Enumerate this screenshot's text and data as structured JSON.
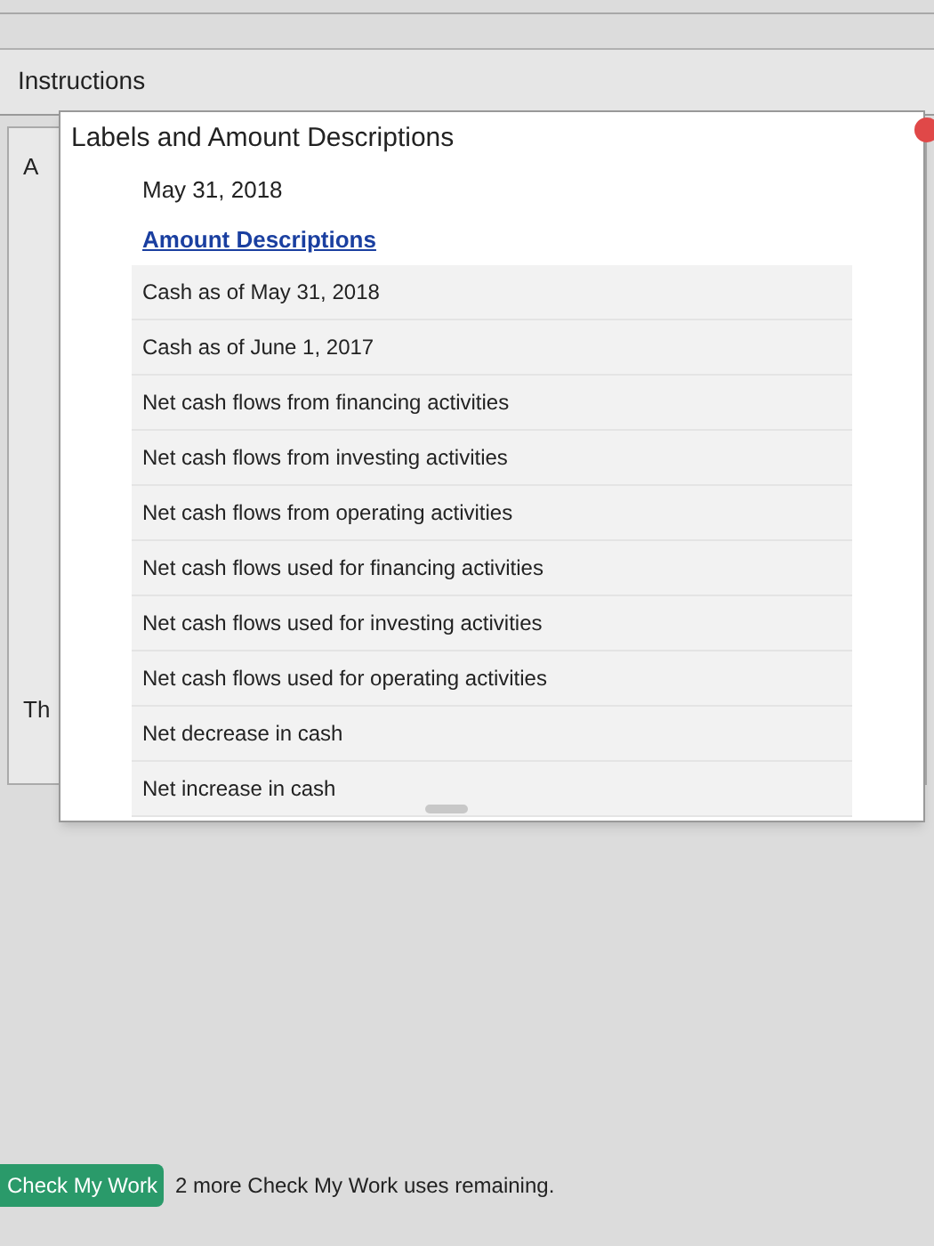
{
  "header": {
    "title": "Instructions"
  },
  "background_panel": {
    "texts": [
      "A",
      "Th"
    ]
  },
  "popup": {
    "title": "Labels and Amount Descriptions",
    "items": [
      {
        "kind": "label",
        "text": "May 31, 2018"
      },
      {
        "kind": "heading",
        "text": "Amount Descriptions"
      },
      {
        "kind": "option",
        "text": "Cash as of May 31, 2018"
      },
      {
        "kind": "option",
        "text": "Cash as of June 1, 2017"
      },
      {
        "kind": "option",
        "text": "Net cash flows from financing activities"
      },
      {
        "kind": "option",
        "text": "Net cash flows from investing activities"
      },
      {
        "kind": "option",
        "text": "Net cash flows from operating activities"
      },
      {
        "kind": "option",
        "text": "Net cash flows used for financing activities"
      },
      {
        "kind": "option",
        "text": "Net cash flows used for investing activities"
      },
      {
        "kind": "option",
        "text": "Net cash flows used for operating activities"
      },
      {
        "kind": "option",
        "text": "Net decrease in cash"
      },
      {
        "kind": "option",
        "text": "Net increase in cash"
      }
    ]
  },
  "footer": {
    "button": "Check My Work",
    "note": "2 more Check My Work uses remaining."
  }
}
